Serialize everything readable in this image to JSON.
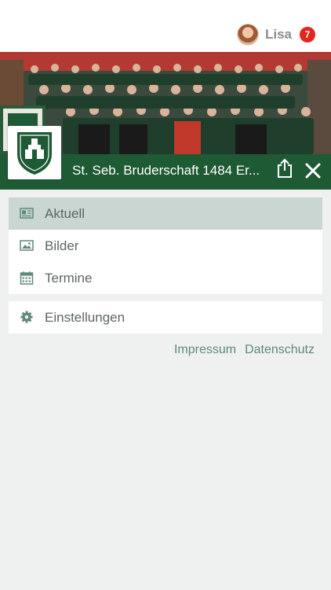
{
  "header": {
    "user_name": "Lisa",
    "notification_count": "7"
  },
  "organization": {
    "title": "St. Seb. Bruderschaft 1484 Er..."
  },
  "menu": {
    "items": [
      {
        "label": "Aktuell",
        "icon": "newspaper-icon",
        "active": true
      },
      {
        "label": "Bilder",
        "icon": "image-icon",
        "active": false
      },
      {
        "label": "Termine",
        "icon": "calendar-icon",
        "active": false
      }
    ],
    "settings_label": "Einstellungen"
  },
  "footer": {
    "impressum": "Impressum",
    "datenschutz": "Datenschutz"
  },
  "colors": {
    "brand_green": "#1e5a34",
    "active_item": "#c9d6d1",
    "link": "#5f8a78",
    "badge": "#e2261f"
  }
}
